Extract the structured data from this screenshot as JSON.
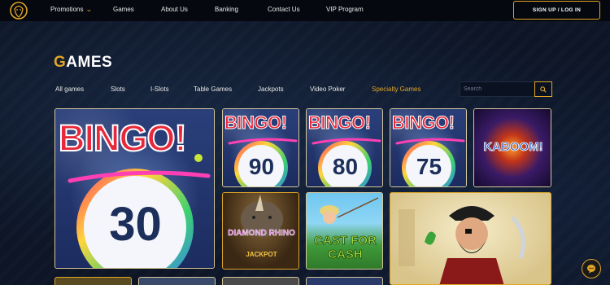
{
  "nav": {
    "items": [
      "Promotions",
      "Games",
      "About Us",
      "Banking",
      "Contact Us",
      "VIP Program"
    ],
    "signup_label": "SIGN UP / LOG IN"
  },
  "page": {
    "title_first": "G",
    "title_rest": "AMES"
  },
  "tabs": {
    "items": [
      "All games",
      "Slots",
      "I-Slots",
      "Table Games",
      "Jackpots",
      "Video Poker",
      "Specialty Games"
    ],
    "active": "Specialty Games"
  },
  "search": {
    "placeholder": "Search"
  },
  "games": [
    {
      "brand": "BINGO!",
      "number": "30"
    },
    {
      "brand": "BINGO!",
      "number": "90"
    },
    {
      "brand": "BINGO!",
      "number": "80"
    },
    {
      "brand": "BINGO!",
      "number": "75"
    },
    {
      "brand": "KABOOM!"
    },
    {
      "brand": "DIAMOND RHINO",
      "sub": "JACKPOT"
    },
    {
      "brand": "CAST FOR",
      "brand2": "CASH"
    },
    {
      "brand": "pirate"
    }
  ],
  "colors": {
    "accent": "#e0a526",
    "bg": "#0d1526",
    "header": "#05080f"
  }
}
